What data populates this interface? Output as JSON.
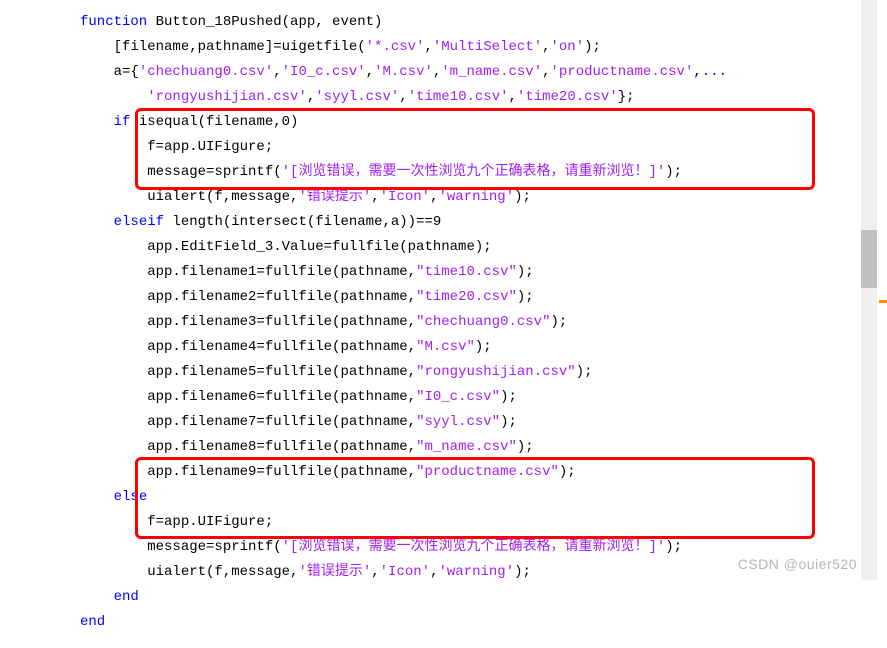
{
  "code": {
    "l1_kw": "function",
    "l1_rest": " Button_18Pushed(app, event)",
    "l2_a": "    [filename,pathname]=uigetfile(",
    "l2_s1": "'*.csv'",
    "l2_c1": ",",
    "l2_s2": "'MultiSelect'",
    "l2_c2": ",",
    "l2_s3": "'on'",
    "l2_c3": ");",
    "l3_a": "    a={",
    "l3_s1": "'chechuang0.csv'",
    "l3_c1": ",",
    "l3_s2": "'I0_c.csv'",
    "l3_c2": ",",
    "l3_s3": "'M.csv'",
    "l3_c3": ",",
    "l3_s4": "'m_name.csv'",
    "l3_c4": ",",
    "l3_s5": "'productname.csv'",
    "l3_c5": ",",
    "l3_kw": "...",
    "l4_a": "        ",
    "l4_s1": "'rongyushijian.csv'",
    "l4_c1": ",",
    "l4_s2": "'syyl.csv'",
    "l4_c2": ",",
    "l4_s3": "'time10.csv'",
    "l4_c3": ",",
    "l4_s4": "'time20.csv'",
    "l4_c4": "};",
    "l5_a": "    ",
    "l5_kw": "if",
    "l5_b": " isequal(filename,0)",
    "l6": "        f=app.UIFigure;",
    "l7_a": "        message=sprintf(",
    "l7_s": "'[浏览错误，需要一次性浏览九个正确表格，请重新浏览！]'",
    "l7_b": ");",
    "l8_a": "        uialert(f,message,",
    "l8_s1": "'错误提示'",
    "l8_c1": ",",
    "l8_s2": "'Icon'",
    "l8_c2": ",",
    "l8_s3": "'warning'",
    "l8_c3": ");",
    "l9_a": "    ",
    "l9_kw": "elseif",
    "l9_b": " length(intersect(filename,a))==9",
    "l10": "        app.EditField_3.Value=fullfile(pathname);",
    "l11_a": "        app.filename1=fullfile(pathname,",
    "l11_s": "\"time10.csv\"",
    "l11_b": ");",
    "l12_a": "        app.filename2=fullfile(pathname,",
    "l12_s": "\"time20.csv\"",
    "l12_b": ");",
    "l13_a": "        app.filename3=fullfile(pathname,",
    "l13_s": "\"chechuang0.csv\"",
    "l13_b": ");",
    "l14_a": "        app.filename4=fullfile(pathname,",
    "l14_s": "\"M.csv\"",
    "l14_b": ");",
    "l15_a": "        app.filename5=fullfile(pathname,",
    "l15_s": "\"rongyushijian.csv\"",
    "l15_b": ");",
    "l16_a": "        app.filename6=fullfile(pathname,",
    "l16_s": "\"I0_c.csv\"",
    "l16_b": ");",
    "l17_a": "        app.filename7=fullfile(pathname,",
    "l17_s": "\"syyl.csv\"",
    "l17_b": ");",
    "l18_a": "        app.filename8=fullfile(pathname,",
    "l18_s": "\"m_name.csv\"",
    "l18_b": ");",
    "l19_a": "        app.filename9=fullfile(pathname,",
    "l19_s": "\"productname.csv\"",
    "l19_b": ");",
    "l20_a": "    ",
    "l20_kw": "else",
    "l21": "        f=app.UIFigure;",
    "l22_a": "        message=sprintf(",
    "l22_s": "'[浏览错误，需要一次性浏览九个正确表格，请重新浏览！]'",
    "l22_b": ");",
    "l23_a": "        uialert(f,message,",
    "l23_s1": "'错误提示'",
    "l23_c1": ",",
    "l23_s2": "'Icon'",
    "l23_c2": ",",
    "l23_s3": "'warning'",
    "l23_c3": ");",
    "l24_a": "    ",
    "l24_kw": "end",
    "l25_kw": "end"
  },
  "colors": {
    "orange": "#ff8c00"
  },
  "watermark": "CSDN @ouier520"
}
